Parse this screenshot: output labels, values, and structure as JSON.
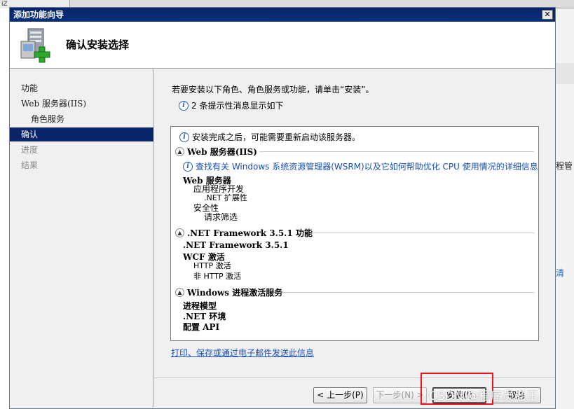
{
  "background": {
    "tab_label": "iZ",
    "side_text_1": "程管",
    "side_text_2": "清"
  },
  "dialog": {
    "title": "添加功能向导",
    "close_label": "✕",
    "header_title": "确认安装选择"
  },
  "nav": {
    "items": [
      {
        "label": "功能"
      },
      {
        "label": "Web 服务器(IIS)"
      },
      {
        "label": "角色服务"
      },
      {
        "label": "确认"
      },
      {
        "label": "进度"
      },
      {
        "label": "结果"
      }
    ]
  },
  "main": {
    "instruction": "若要安装以下角色、角色服务或功能，请单击“安装”。",
    "notice": "2 条提示性消息显示如下",
    "warning": "安装完成之后，可能需要重新启动该服务器。",
    "sections": [
      {
        "title": "Web 服务器(IIS)",
        "link": "查找有关 Windows 系统资源管理器(WSRM)以及它如何帮助优化 CPU 使用情况的详细信息",
        "lines": [
          "Web 服务器",
          "应用程序开发",
          ".NET 扩展性",
          "安全性",
          "请求筛选"
        ]
      },
      {
        "title": ".NET Framework 3.5.1 功能",
        "lines": [
          ".NET Framework 3.5.1",
          "WCF 激活",
          "HTTP 激活",
          "非 HTTP 激活"
        ]
      },
      {
        "title": "Windows 进程激活服务",
        "lines": [
          "进程模型",
          ".NET 环境",
          "配置 API"
        ]
      }
    ],
    "print_link": "打印、保存或通过电子邮件发送此信息"
  },
  "buttons": {
    "back": "< 上一步(P)",
    "next": "下一步(N) >",
    "install": "安装(I)",
    "cancel": "取消"
  },
  "watermark": "CSDN @程序员老王",
  "colors": {
    "titlebar": "#0a246a",
    "selection": "#0a246a",
    "link": "#1a4fb5",
    "highlight_box": "#e8121a"
  }
}
